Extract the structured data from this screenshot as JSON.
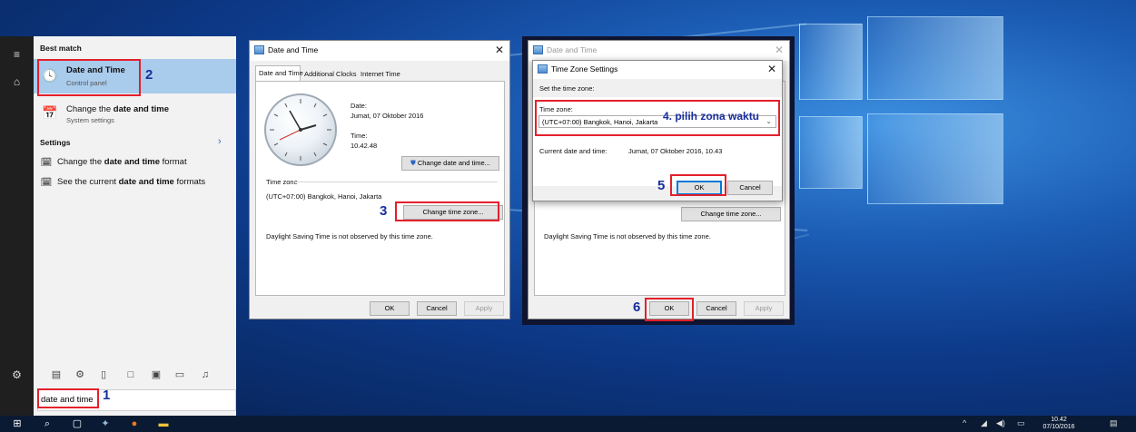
{
  "start_menu": {
    "best_match_title": "Best match",
    "results": [
      {
        "title": "Date and Time",
        "subtitle": "Control panel",
        "icon": "clock-panel-icon"
      },
      {
        "title_pre": "Change the ",
        "title_bold": "date and time",
        "subtitle": "System settings",
        "icon": "calendar-clock-icon"
      }
    ],
    "settings_title": "Settings",
    "settings_items": [
      {
        "pre": "Change the ",
        "bold": "date and time",
        "post": " format"
      },
      {
        "pre": "See the current ",
        "bold": "date and time",
        "post": " formats"
      }
    ],
    "search_value": "date and time"
  },
  "dialog1": {
    "title": "Date and Time",
    "tabs": [
      "Date and Time",
      "Additional Clocks",
      "Internet Time"
    ],
    "date_label": "Date:",
    "date_value": "Jumat, 07 Oktober 2016",
    "time_label": "Time:",
    "time_value": "10.42.48",
    "change_datetime_button": "Change date and time...",
    "timezone_label": "Time zone",
    "timezone_value": "(UTC+07:00) Bangkok, Hanoi, Jakarta",
    "change_timezone_button": "Change time zone...",
    "dst_text": "Daylight Saving Time is not observed by this time zone.",
    "ok": "OK",
    "cancel": "Cancel",
    "apply": "Apply"
  },
  "dialog2": {
    "title": "Date and Time",
    "change_timezone_button": "Change time zone...",
    "dst_text": "Daylight Saving Time is not observed by this time zone.",
    "ok": "OK",
    "cancel": "Cancel",
    "apply": "Apply"
  },
  "tz_dialog": {
    "title": "Time Zone Settings",
    "set_label": "Set the time zone:",
    "tz_label": "Time zone:",
    "tz_selected": "(UTC+07:00) Bangkok, Hanoi, Jakarta",
    "current_label": "Current date and time:",
    "current_value": "Jumat, 07 Oktober 2016, 10.43",
    "ok": "OK",
    "cancel": "Cancel"
  },
  "annotations": {
    "s1": "1",
    "s2": "2",
    "s3": "3",
    "s4": "4. pilih zona waktu",
    "s5": "5",
    "s6": "6",
    "color": "#e3202c",
    "step_color": "#1a2f9e"
  },
  "taskbar": {
    "time": "10.42",
    "date": "07/10/2016"
  }
}
